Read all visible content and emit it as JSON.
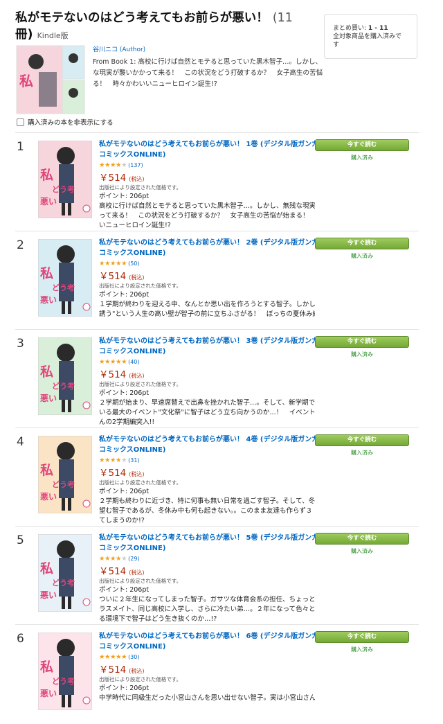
{
  "series": {
    "title": "私がモテないのはどう考えてもお前らが悪い！",
    "count": "(11",
    "count_end": "冊)",
    "format": "Kindle版",
    "author": "谷川ニコ (Author)",
    "description": [
      "From Book 1: 高校に行けば自然とモテると思っていた黒木智子…。しかし、",
      "な現実が襲いかかって来る！　この状況をどう打破するか？　女子高生の苦悩",
      "る！　時々かわいいニューヒロイン誕生!?"
    ]
  },
  "summary": {
    "line1_label": "まとめ買い: ",
    "line1_value": "1 - 11",
    "line2": "全対象商品を購入済みで",
    "line3": "す"
  },
  "hide_purchased_label": "購入済みの本を非表示にする",
  "colors": {
    "link": "#0066c0",
    "price": "#b12704",
    "button": "#84b645",
    "owned": "#258a25",
    "star": "#f0a020"
  },
  "items": [
    {
      "number": "1",
      "title": "私がモテないのはどう考えてもお前らが悪い！ 1巻 (デジタル版ガンガン",
      "title2": "コミックスONLINE)",
      "stars": "★★★★",
      "star_empty": "★",
      "rating_count": "(137)",
      "price": "￥514",
      "tax": "(税込)",
      "price_note": "出版社により設定された価格です。",
      "points": "ポイント: 206pt",
      "desc": [
        "高校に行けば自然とモテると思っていた黒木智子…。しかし、無残な現実",
        "って来る！　この状況をどう打破するか？　女子高生の苦悩が始まる！　時",
        "いニューヒロイン誕生!?"
      ],
      "button": "今すぐ読む",
      "owned": "購入済み",
      "cover_color": "#f6d6dc"
    },
    {
      "number": "2",
      "title": "私がモテないのはどう考えてもお前らが悪い！ 2巻 (デジタル版ガンガン",
      "title2": "コミックスONLINE)",
      "stars": "★★★★★",
      "star_empty": "",
      "rating_count": "(50)",
      "price": "￥514",
      "tax": "(税込)",
      "price_note": "出版社により設定された価格です。",
      "points": "ポイント: 206pt",
      "desc": [
        "１学期が終わりを迎える中、なんとか思い出を作ろうとする智子。しかし",
        "誘う\"という人生の高い壁が智子の前に立ちふさがる！　ぼっちの夏休み編"
      ],
      "button": "今すぐ読む",
      "owned": "購入済み",
      "cover_color": "#d8ecf4"
    },
    {
      "number": "3",
      "title": "私がモテないのはどう考えてもお前らが悪い！ 3巻 (デジタル版ガンガン",
      "title2": "コミックスONLINE)",
      "stars": "★★★★★",
      "star_empty": "",
      "rating_count": "(40)",
      "price": "￥514",
      "tax": "(税込)",
      "price_note": "出版社により設定された価格です。",
      "points": "ポイント: 206pt",
      "desc": [
        "２学期が始まり、早速席替えで出鼻を挫かれた智子…。そして、新学期で",
        "いる最大のイベント\"文化祭\"に智子はどう立ち向かうのか…！　イベント",
        "んの2学期編突入!!"
      ],
      "button": "今すぐ読む",
      "owned": "購入済み",
      "cover_color": "#d9efd9"
    },
    {
      "number": "4",
      "title": "私がモテないのはどう考えてもお前らが悪い！ 4巻 (デジタル版ガンガン",
      "title2": "コミックスONLINE)",
      "stars": "★★★★",
      "star_empty": "★",
      "rating_count": "(31)",
      "price": "￥514",
      "tax": "(税込)",
      "price_note": "出版社により設定された価格です。",
      "points": "ポイント: 206pt",
      "desc": [
        "２学期も終わりに近づき、特に何事も無い日常を過ごす智子。そして、冬",
        "望む智子であるが、冬休み中も何も起きない。。このまま友達も作らず３",
        "てしまうのか!?"
      ],
      "button": "今すぐ読む",
      "owned": "購入済み",
      "cover_color": "#fbe3c6"
    },
    {
      "number": "5",
      "title": "私がモテないのはどう考えてもお前らが悪い！ 5巻 (デジタル版ガンガン",
      "title2": "コミックスONLINE)",
      "stars": "★★★★",
      "star_empty": "★",
      "rating_count": "(29)",
      "price": "￥514",
      "tax": "(税込)",
      "price_note": "出版社により設定された価格です。",
      "points": "ポイント: 206pt",
      "desc": [
        "ついに２年生になってしまった智子。ガサツな体育会系の担任、ちょっと",
        "ラスメイト、同じ高校に入学し、さらに冷たい弟…。２年になって色々と",
        "る環境下で智子はどう生き抜くのか…!?"
      ],
      "button": "今すぐ読む",
      "owned": "購入済み",
      "cover_color": "#e7f1f7"
    },
    {
      "number": "6",
      "title": "私がモテないのはどう考えてもお前らが悪い！ 6巻 (デジタル版ガンガン",
      "title2": "コミックスONLINE)",
      "stars": "★★★★★",
      "star_empty": "",
      "rating_count": "(30)",
      "price": "￥514",
      "tax": "(税込)",
      "price_note": "出版社により設定された価格です。",
      "points": "ポイント: 206pt",
      "desc": [
        "中学時代に同級生だった小宮山さんを思い出せない智子。実は小宮山さん"
      ],
      "button": "今すぐ読む",
      "owned": "購入済み",
      "cover_color": "#fde4ea"
    }
  ]
}
